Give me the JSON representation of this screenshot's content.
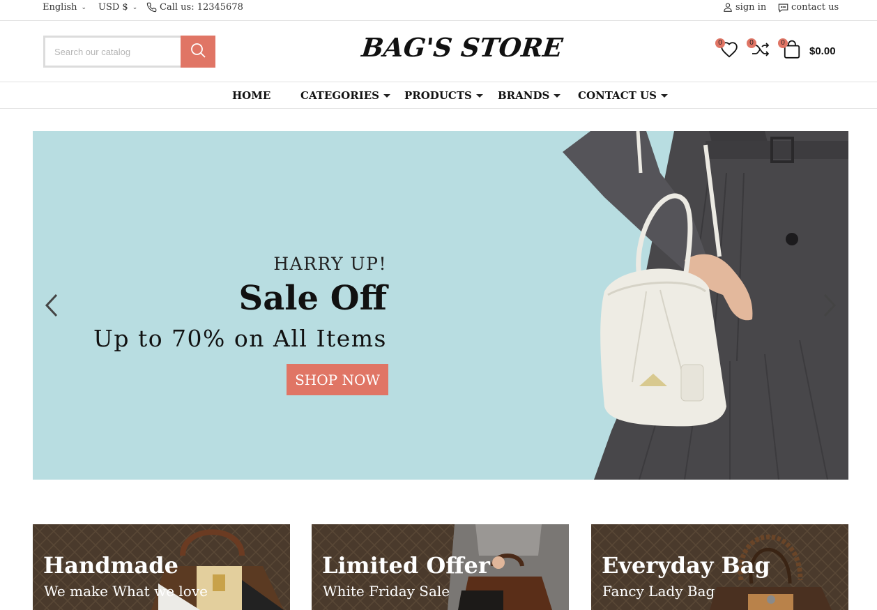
{
  "topbar": {
    "language": "English",
    "currency": "USD $",
    "phone": "Call us: 12345678",
    "sign_in": "sign in",
    "contact": "contact us"
  },
  "header": {
    "search_placeholder": "Search our catalog",
    "logo": "BAG'S STORE",
    "wishlist_count": "0",
    "compare_count": "0",
    "cart_count": "0",
    "cart_total": "$0.00"
  },
  "nav": {
    "items": [
      {
        "label": "HOME"
      },
      {
        "label": "CATEGORIES"
      },
      {
        "label": "PRODUCTS"
      },
      {
        "label": "BRANDS"
      },
      {
        "label": "CONTACT US"
      }
    ]
  },
  "hero": {
    "kicker": "HARRY UP!",
    "title": "Sale Off",
    "subtitle": "Up to 70% on All Items",
    "button": "SHOP NOW"
  },
  "banners": [
    {
      "title": "Handmade",
      "subtitle": "We make What we love"
    },
    {
      "title": "Limited Offer",
      "subtitle": "White Friday Sale"
    },
    {
      "title": "Everyday Bag",
      "subtitle": "Fancy Lady Bag"
    }
  ],
  "colors": {
    "accent": "#e07565",
    "hero_bg": "#b8dde1",
    "text": "#111111"
  }
}
